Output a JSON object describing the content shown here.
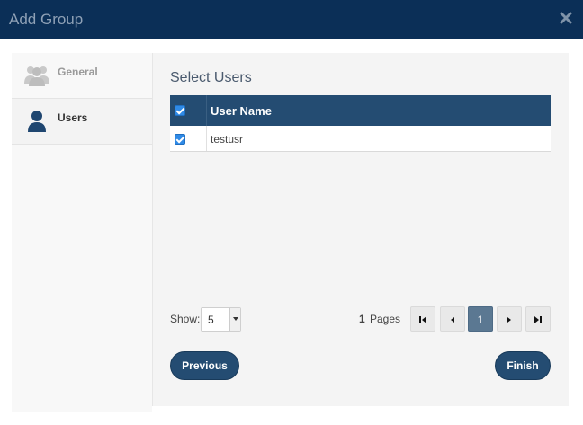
{
  "dialog": {
    "title": "Add Group",
    "close_icon": "close-icon"
  },
  "sidebar": {
    "items": [
      {
        "label": "General",
        "icon": "users-group-icon",
        "active": false
      },
      {
        "label": "Users",
        "icon": "user-icon",
        "active": true
      }
    ]
  },
  "main": {
    "section_title": "Select Users",
    "table": {
      "header_checked": true,
      "columns": [
        "User Name"
      ],
      "rows": [
        {
          "checked": true,
          "user_name": "testusr"
        }
      ]
    },
    "pagination": {
      "show_label": "Show:",
      "page_size": "5",
      "page_count": "1",
      "pages_label": "Pages",
      "current_page": "1"
    },
    "buttons": {
      "previous": "Previous",
      "finish": "Finish"
    }
  },
  "colors": {
    "titlebar": "#0b2f57",
    "accent": "#244c72",
    "checkbox": "#2f8ae6"
  }
}
